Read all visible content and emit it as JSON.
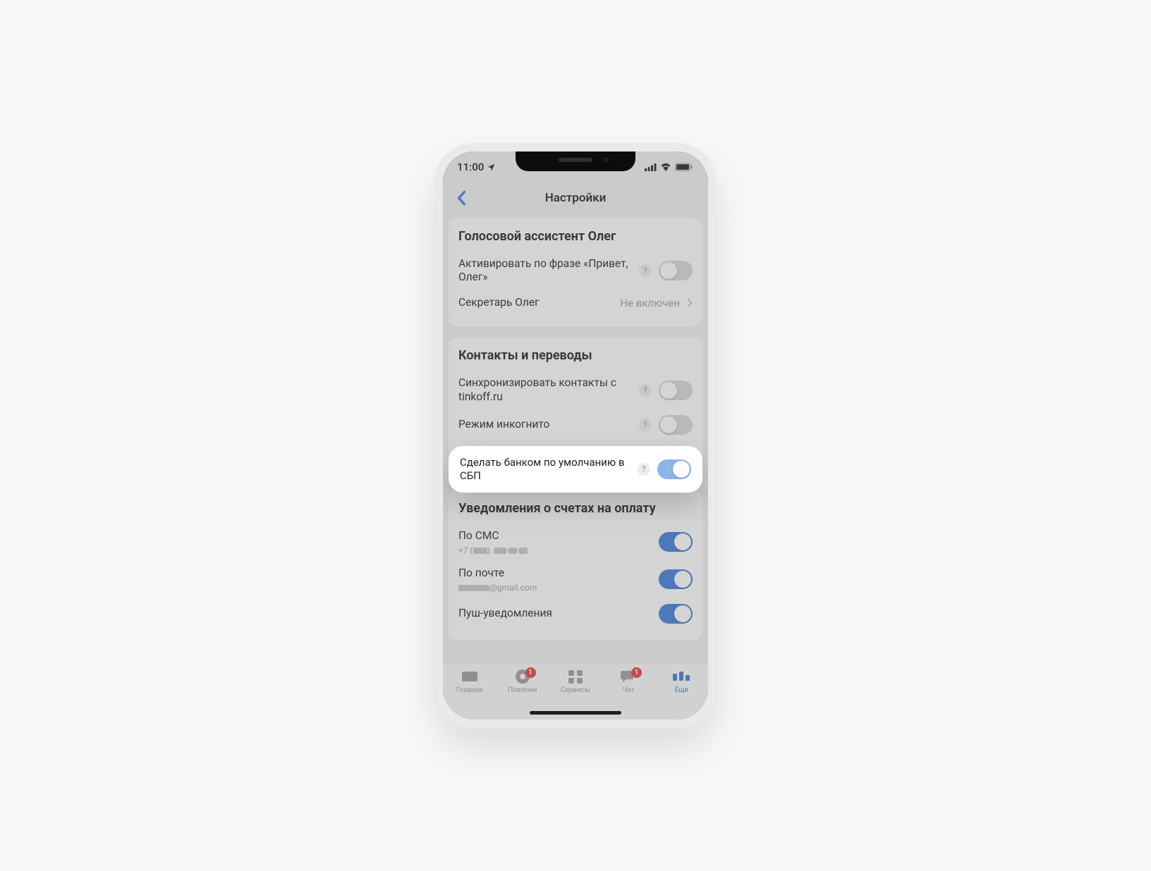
{
  "status": {
    "time": "11:00"
  },
  "nav": {
    "title": "Настройки"
  },
  "sections": {
    "assistant": {
      "title": "Голосовой ассистент Олег",
      "activate_label": "Активировать по фразе «Привет, Олег»",
      "secretary_label": "Секретарь Олег",
      "secretary_value": "Не включен"
    },
    "contacts": {
      "title": "Контакты и переводы",
      "sync_label": "Синхронизировать контакты с tinkoff.ru",
      "incognito_label": "Режим инкогнито",
      "sbp_label": "Сделать банком по умолчанию в СБП"
    },
    "notifications": {
      "title": "Уведомления о счетах на оплату",
      "sms_label": "По СМС",
      "sms_sub_prefix": "+7 (",
      "sms_sub_suffix": ")",
      "email_label": "По почте",
      "email_suffix": "@gmail.com",
      "push_label": "Пуш-уведомления"
    }
  },
  "tabs": {
    "home": "Главная",
    "payments": "Платежи",
    "services": "Сервисы",
    "chat": "Чат",
    "more": "Еще"
  },
  "badges": {
    "payments": "1",
    "chat": "1"
  }
}
